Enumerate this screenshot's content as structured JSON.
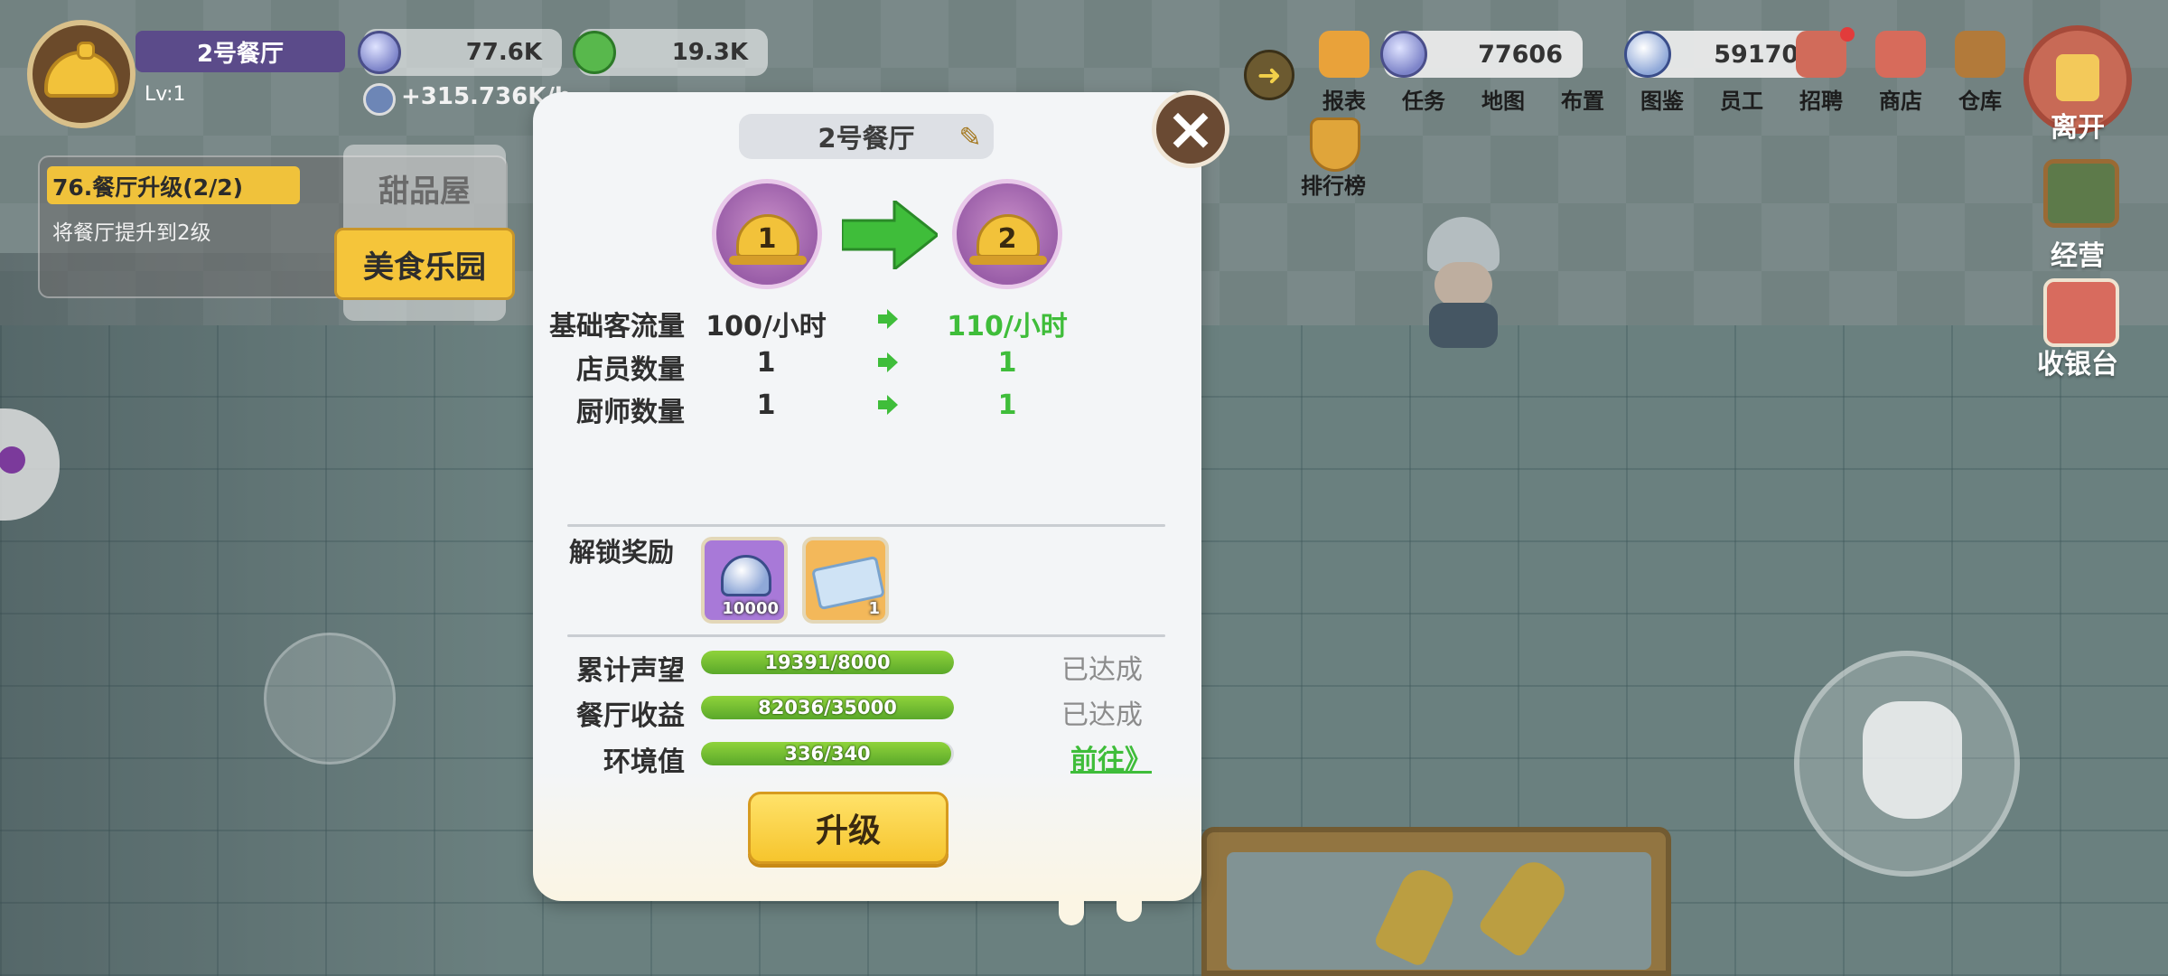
{
  "hud": {
    "restaurant_name": "2号餐厅",
    "level": "Lv:1",
    "resource_1": "77.6K",
    "resource_2": "19.3K",
    "income_rate": "+315.736K/h"
  },
  "quest": {
    "title": "76.餐厅升级(2/2)",
    "description": "将餐厅提升到2级"
  },
  "side_tabs": [
    "甜品屋",
    "美食乐园"
  ],
  "top_right": {
    "currency_1": "77606",
    "currency_2": "591700",
    "menu": [
      {
        "label": "报表",
        "icon": "report-icon"
      },
      {
        "label": "任务",
        "icon": "task-icon"
      },
      {
        "label": "地图",
        "icon": "map-icon"
      },
      {
        "label": "布置",
        "icon": "decorate-icon"
      },
      {
        "label": "图鉴",
        "icon": "collection-icon"
      },
      {
        "label": "员工",
        "icon": "staff-icon"
      },
      {
        "label": "招聘",
        "icon": "recruit-icon"
      },
      {
        "label": "商店",
        "icon": "shop-icon"
      },
      {
        "label": "仓库",
        "icon": "warehouse-icon"
      }
    ],
    "ranking_label": "排行榜",
    "leave_label": "离开",
    "manage_label": "经营",
    "cashier_label": "收银台"
  },
  "modal": {
    "restaurant_name": "2号餐厅",
    "current_level": "1",
    "next_level": "2",
    "stats": [
      {
        "label": "基础客流量",
        "current": "100/小时",
        "next": "110/小时"
      },
      {
        "label": "店员数量",
        "current": "1",
        "next": "1"
      },
      {
        "label": "厨师数量",
        "current": "1",
        "next": "1"
      }
    ],
    "reward_title": "解锁奖励",
    "rewards": [
      {
        "name": "silver-cloche",
        "count": "10000"
      },
      {
        "name": "ticket",
        "count": "1"
      }
    ],
    "requirements": [
      {
        "label": "累计声望",
        "progress_text": "19391/8000",
        "progress": 1.0,
        "status": "已达成"
      },
      {
        "label": "餐厅收益",
        "progress_text": "82036/35000",
        "progress": 1.0,
        "status": "已达成"
      },
      {
        "label": "环境值",
        "progress_text": "336/340",
        "progress": 0.988,
        "link": "前往》"
      }
    ],
    "upgrade_label": "升级"
  },
  "colors": {
    "accent_yellow": "#f5c53a",
    "success_green": "#3fbd3a",
    "progress_green": "#6fbf2f"
  }
}
